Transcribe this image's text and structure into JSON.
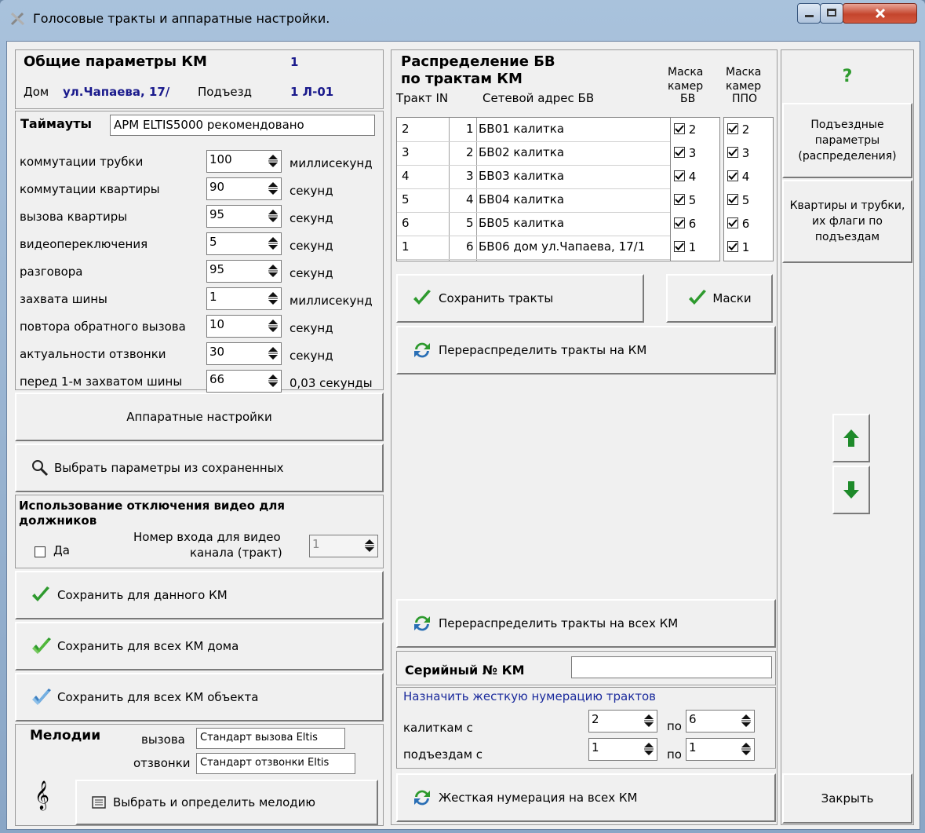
{
  "window": {
    "title": "Голосовые тракты и аппаратные настройки."
  },
  "general": {
    "title": "Общие параметры КМ",
    "km_number": "1",
    "house_label": "Дом",
    "house_value": "ул.Чапаева, 17/",
    "entrance_label": "Подъезд",
    "entrance_value": "1 Л-01"
  },
  "timeouts": {
    "title": "Таймауты",
    "preset": "АРМ ELTIS5000 рекомендовано",
    "rows": [
      {
        "label": "коммутации трубки",
        "value": "100",
        "unit": "миллисекунд"
      },
      {
        "label": "коммутации квартиры",
        "value": "90",
        "unit": "секунд"
      },
      {
        "label": "вызова квартиры",
        "value": "95",
        "unit": "секунд"
      },
      {
        "label": "видеопереключения",
        "value": "5",
        "unit": "секунд"
      },
      {
        "label": "разговора",
        "value": "95",
        "unit": "секунд"
      },
      {
        "label": "захвата шины",
        "value": "1",
        "unit": "миллисекунд"
      },
      {
        "label": "повтора обратного вызова",
        "value": "10",
        "unit": "секунд"
      },
      {
        "label": "актуальности отзвонки",
        "value": "30",
        "unit": "секунд"
      },
      {
        "label": "перед 1-м захватом шины",
        "value": "66",
        "unit": "0,03 секунды"
      }
    ]
  },
  "buttons": {
    "hardware": "Аппаратные настройки",
    "choose_saved": "Выбрать параметры из сохраненных",
    "save_this": "Сохранить для данного КМ",
    "save_house": "Сохранить для всех КМ дома",
    "save_object": "Сохранить для всех КМ объекта",
    "choose_melody": "Выбрать и определить мелодию",
    "save_paths": "Сохранить тракты",
    "masks": "Маски",
    "redistribute": "Перераспределить тракты на КМ",
    "redistribute_all": "Перераспределить тракты на всех КМ",
    "hard_numbering": "Жесткая нумерация на всех КМ",
    "help": "?",
    "entrance_params": "Подъездные параметры (распределения)",
    "apartments": "Квартиры и трубки, их флаги по подъездам",
    "close": "Закрыть"
  },
  "video_disable": {
    "title": "Использование отключения видео для должников",
    "checkbox_label": "Да",
    "input_label_1": "Номер входа для видео",
    "input_label_2": "канала (тракт)",
    "input_value": "1"
  },
  "melodies": {
    "title": "Мелодии",
    "call_label": "вызова",
    "call_value": "Стандарт вызова Eltis",
    "callback_label": "отзвонки",
    "callback_value": "Стандарт отзвонки Eltis"
  },
  "distribution": {
    "title_1": "Распределение БВ",
    "title_2": "по трактам КМ",
    "col_path": "Тракт IN",
    "col_address": "Сетевой адрес БВ",
    "col_mask_bv": "Маска камер БВ",
    "col_mask_ppo": "Маска камер ППО",
    "mask_bv_1": "Маска",
    "mask_bv_2": "камер",
    "mask_bv_3": "БВ",
    "mask_ppo_1": "Маска",
    "mask_ppo_2": "камер",
    "mask_ppo_3": "ППО",
    "rows": [
      {
        "path": "2",
        "in": "1",
        "address": "БВ01 калитка",
        "mask_bv": "2",
        "mask_ppo": "2"
      },
      {
        "path": "3",
        "in": "2",
        "address": "БВ02 калитка",
        "mask_bv": "3",
        "mask_ppo": "3"
      },
      {
        "path": "4",
        "in": "3",
        "address": "БВ03 калитка",
        "mask_bv": "4",
        "mask_ppo": "4"
      },
      {
        "path": "5",
        "in": "4",
        "address": "БВ04 калитка",
        "mask_bv": "5",
        "mask_ppo": "5"
      },
      {
        "path": "6",
        "in": "5",
        "address": "БВ05 калитка",
        "mask_bv": "6",
        "mask_ppo": "6"
      },
      {
        "path": "1",
        "in": "6",
        "address": "БВ06 дом ул.Чапаева, 17/1",
        "mask_bv": "1",
        "mask_ppo": "1"
      }
    ]
  },
  "serial": {
    "label": "Серийный № КМ",
    "value": ""
  },
  "hard_numbering": {
    "title": "Назначить жесткую нумерацию трактов",
    "gates_label": "калиткам с",
    "gates_from": "2",
    "gates_to_label": "по",
    "gates_to": "6",
    "entrances_label": "подъездам с",
    "entrances_from": "1",
    "entrances_to_label": "по",
    "entrances_to": "1"
  },
  "colors": {
    "accent_blue": "#1a1a8c",
    "check_green": "#2e9a2e",
    "link_blue": "#1a2a9c"
  }
}
